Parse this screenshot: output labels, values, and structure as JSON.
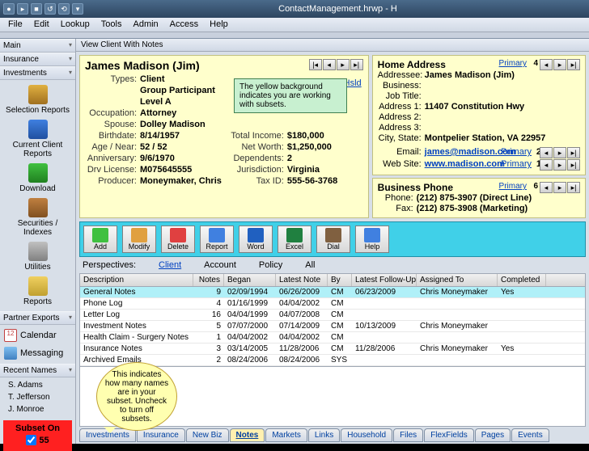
{
  "window": {
    "title": "ContactManagement.hrwp - H"
  },
  "menu": [
    "File",
    "Edit",
    "Lookup",
    "Tools",
    "Admin",
    "Access",
    "Help"
  ],
  "sidebar": {
    "sections": {
      "main": "Main",
      "insurance": "Insurance",
      "investments": "Investments",
      "partner": "Partner Exports",
      "recent": "Recent Names"
    },
    "inv_items": [
      "Selection Reports",
      "Current Client Reports",
      "Download",
      "Securities / Indexes",
      "Utilities",
      "Reports"
    ],
    "partner_items": [
      "Calendar",
      "Messaging"
    ],
    "recent_names": [
      "S. Adams",
      "T. Jefferson",
      "J. Monroe"
    ],
    "subset": {
      "title": "Subset On",
      "count": "55"
    }
  },
  "view_title": "View Client With Notes",
  "client": {
    "name": "James Madison (Jim)",
    "head": "Head of Hsld",
    "rows_left": [
      {
        "l": "Types:",
        "v": "Client"
      },
      {
        "l": "",
        "v": "Group Participant"
      },
      {
        "l": "",
        "v": "Level A"
      },
      {
        "l": "Occupation:",
        "v": "Attorney"
      },
      {
        "l": "Spouse:",
        "v": "Dolley Madison"
      },
      {
        "l": "Birthdate:",
        "v": "8/14/1957"
      },
      {
        "l": "Age / Near:",
        "v": "52 / 52"
      },
      {
        "l": "Anniversary:",
        "v": "9/6/1970"
      },
      {
        "l": "Drv License:",
        "v": "M075645555"
      },
      {
        "l": "Producer:",
        "v": "Moneymaker, Chris"
      }
    ],
    "rows_right": [
      {
        "l": "Total Income:",
        "v": "$180,000"
      },
      {
        "l": "Net Worth:",
        "v": "$1,250,000"
      },
      {
        "l": "Dependents:",
        "v": "2"
      },
      {
        "l": "Jurisdiction:",
        "v": "Virginia"
      },
      {
        "l": "Tax ID:",
        "v": "555-56-3768"
      }
    ]
  },
  "address": {
    "title": "Home Address",
    "primary": "Primary",
    "primary_n": "4",
    "rows": [
      {
        "l": "Addressee:",
        "v": "James Madison (Jim)"
      },
      {
        "l": "Business:",
        "v": ""
      },
      {
        "l": "Job Title:",
        "v": ""
      },
      {
        "l": "Address 1:",
        "v": "11407 Constitution Hwy"
      },
      {
        "l": "Address 2:",
        "v": ""
      },
      {
        "l": "Address 3:",
        "v": ""
      },
      {
        "l": "City, State:",
        "v": "Montpelier Station,   VA   22957"
      }
    ],
    "email_l": "Email:",
    "email": "james@madison.com",
    "email_p": "2",
    "web_l": "Web Site:",
    "web": "www.madison.com",
    "web_p": "1"
  },
  "phone": {
    "title": "Business Phone",
    "primary": "Primary",
    "primary_n": "6",
    "rows": [
      {
        "l": "Phone:",
        "v": "(212) 875-3907  (Direct Line)"
      },
      {
        "l": "Fax:",
        "v": "(212) 875-3908  (Marketing)"
      }
    ]
  },
  "hint_yellow": "The yellow background indicates you are working with subsets.",
  "callout": "This indicates how many names are in your subset. Uncheck to turn off subsets.",
  "toolbar": [
    "Add",
    "Modify",
    "Delete",
    "Report",
    "Word",
    "Excel",
    "Dial",
    "Help"
  ],
  "perspectives": {
    "label": "Perspectives:",
    "items": [
      "Client",
      "Account",
      "Policy",
      "All"
    ]
  },
  "table": {
    "columns": [
      "Description",
      "Notes",
      "Began",
      "Latest Note",
      "By",
      "Latest Follow-Up",
      "Assigned To",
      "Completed"
    ],
    "rows": [
      {
        "d": "General Notes",
        "n": "9",
        "b": "02/09/1994",
        "ln": "06/26/2009",
        "by": "CM",
        "lf": "06/23/2009",
        "at": "Chris Moneymaker",
        "c": "Yes",
        "hl": true
      },
      {
        "d": "Phone Log",
        "n": "4",
        "b": "01/16/1999",
        "ln": "04/04/2002",
        "by": "CM",
        "lf": "",
        "at": "",
        "c": ""
      },
      {
        "d": "Letter Log",
        "n": "16",
        "b": "04/04/1999",
        "ln": "04/07/2008",
        "by": "CM",
        "lf": "",
        "at": "",
        "c": ""
      },
      {
        "d": "Investment Notes",
        "n": "5",
        "b": "07/07/2000",
        "ln": "07/14/2009",
        "by": "CM",
        "lf": "10/13/2009",
        "at": "Chris Moneymaker",
        "c": ""
      },
      {
        "d": "Health Claim - Surgery Notes",
        "n": "1",
        "b": "04/04/2002",
        "ln": "04/04/2002",
        "by": "CM",
        "lf": "",
        "at": "",
        "c": ""
      },
      {
        "d": "Insurance Notes",
        "n": "3",
        "b": "03/14/2005",
        "ln": "11/28/2006",
        "by": "CM",
        "lf": "11/28/2006",
        "at": "Chris Moneymaker",
        "c": "Yes"
      },
      {
        "d": "Archived Emails",
        "n": "2",
        "b": "08/24/2006",
        "ln": "08/24/2006",
        "by": "SYS",
        "lf": "",
        "at": "",
        "c": ""
      }
    ]
  },
  "tabs": [
    "Investments",
    "Insurance",
    "New Biz",
    "Notes",
    "Markets",
    "Links",
    "Household",
    "Files",
    "FlexFields",
    "Pages",
    "Events"
  ],
  "active_tab": "Notes"
}
